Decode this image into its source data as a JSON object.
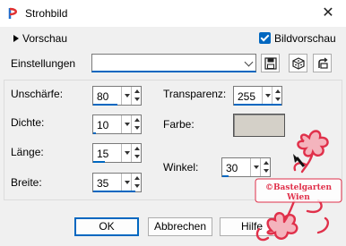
{
  "window": {
    "title": "Strohbild",
    "close_glyph": "✕"
  },
  "toolbar": {
    "preview_label": "Vorschau",
    "preview_checkbox_label": "Bildvorschau"
  },
  "settings": {
    "label": "Einstellungen",
    "value": ""
  },
  "params": {
    "blur": {
      "label": "Unschärfe:",
      "value": "80"
    },
    "density": {
      "label": "Dichte:",
      "value": "10"
    },
    "length": {
      "label": "Länge:",
      "value": "15"
    },
    "width": {
      "label": "Breite:",
      "value": "35"
    },
    "transparency": {
      "label": "Transparenz:",
      "value": "255"
    },
    "color": {
      "label": "Farbe:",
      "value": "#d4d0c8"
    },
    "angle": {
      "label": "Winkel:",
      "value": "30"
    }
  },
  "buttons": {
    "ok": "OK",
    "cancel": "Abbrechen",
    "help": "Hilfe"
  },
  "watermark": {
    "line1": "©Bastelgarten",
    "line2": "Wien"
  },
  "colors": {
    "accent": "#0067c0",
    "watermark": "#e0304a"
  }
}
